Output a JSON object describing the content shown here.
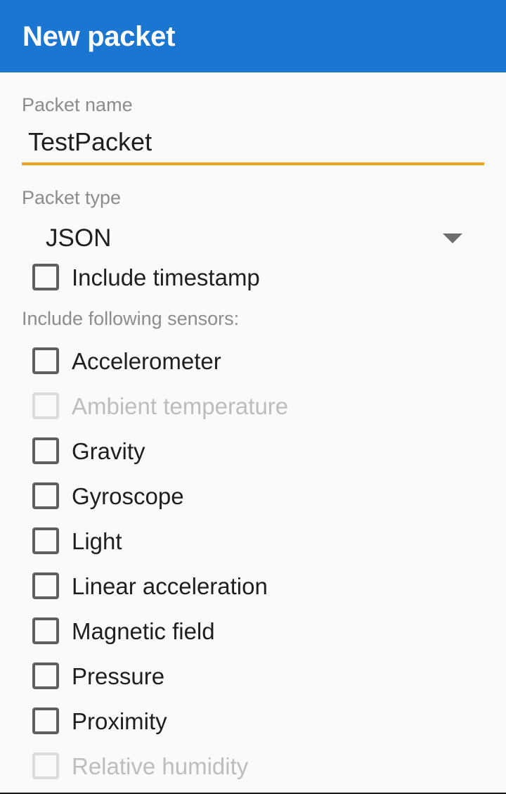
{
  "appbar": {
    "title": "New packet"
  },
  "form": {
    "packet_name": {
      "label": "Packet name",
      "value": "TestPacket",
      "underline_color": "#eda320"
    },
    "packet_type": {
      "label": "Packet type",
      "value": "JSON",
      "arrow_icon": "chevron-down-icon"
    },
    "timestamp": {
      "label": "Include timestamp",
      "checked": false,
      "enabled": true
    },
    "sensors_section_label": "Include following sensors:",
    "sensors": [
      {
        "label": "Accelerometer",
        "checked": false,
        "enabled": true
      },
      {
        "label": "Ambient temperature",
        "checked": false,
        "enabled": false
      },
      {
        "label": "Gravity",
        "checked": false,
        "enabled": true
      },
      {
        "label": "Gyroscope",
        "checked": false,
        "enabled": true
      },
      {
        "label": "Light",
        "checked": false,
        "enabled": true
      },
      {
        "label": "Linear acceleration",
        "checked": false,
        "enabled": true
      },
      {
        "label": "Magnetic field",
        "checked": false,
        "enabled": true
      },
      {
        "label": "Pressure",
        "checked": false,
        "enabled": true
      },
      {
        "label": "Proximity",
        "checked": false,
        "enabled": true
      },
      {
        "label": "Relative humidity",
        "checked": false,
        "enabled": false
      }
    ]
  },
  "colors": {
    "appbar_background": "#1b76d2",
    "page_background": "#fafafa",
    "accent": "#eda320",
    "label_text": "#8c8c8c",
    "primary_text": "#1f1f1f",
    "disabled_text": "#bdbdbd"
  }
}
